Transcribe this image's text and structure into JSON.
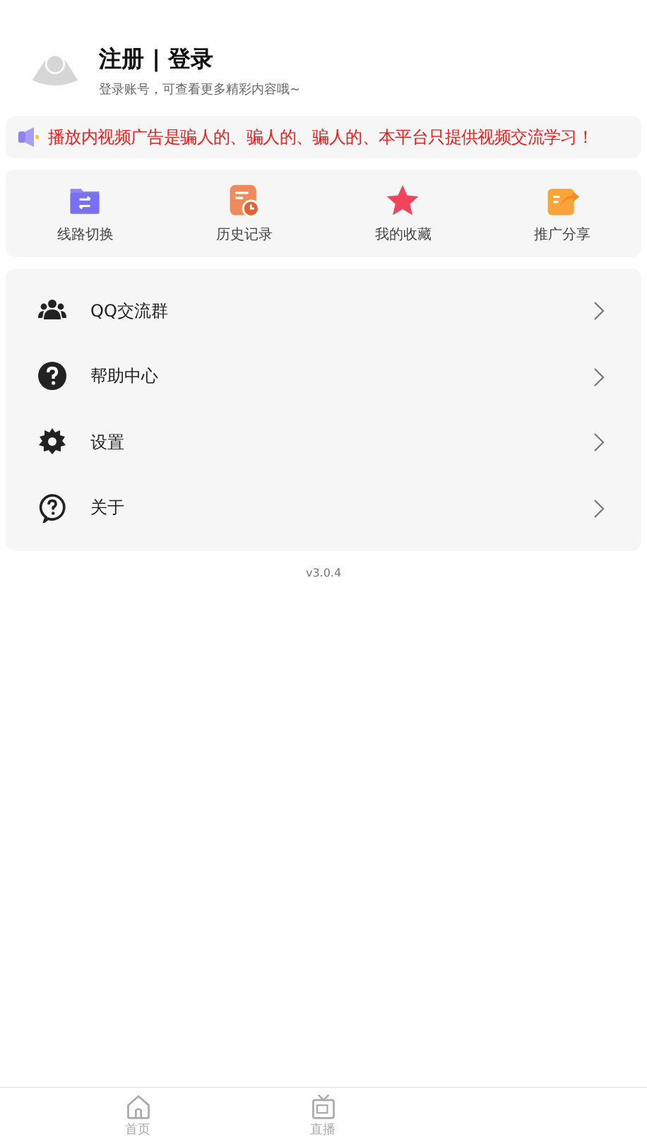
{
  "profile": {
    "title": "注册 | 登录",
    "subtitle": "登录账号，可查看更多精彩内容哦~"
  },
  "notice": {
    "text": "播放内视频广告是骗人的、骗人的、骗人的、本平台只提供视频交流学习！"
  },
  "shortcuts": [
    {
      "kind": "switch",
      "label": "线路切换"
    },
    {
      "kind": "history",
      "label": "历史记录"
    },
    {
      "kind": "favorite",
      "label": "我的收藏"
    },
    {
      "kind": "share",
      "label": "推广分享"
    }
  ],
  "menu": [
    {
      "kind": "group",
      "label": "QQ交流群"
    },
    {
      "kind": "help",
      "label": "帮助中心"
    },
    {
      "kind": "settings",
      "label": "设置"
    },
    {
      "kind": "about",
      "label": "关于"
    }
  ],
  "version": "v3.0.4",
  "tab_bar": [
    {
      "kind": "home",
      "label": "首页"
    },
    {
      "kind": "tv",
      "label": "直播"
    }
  ]
}
